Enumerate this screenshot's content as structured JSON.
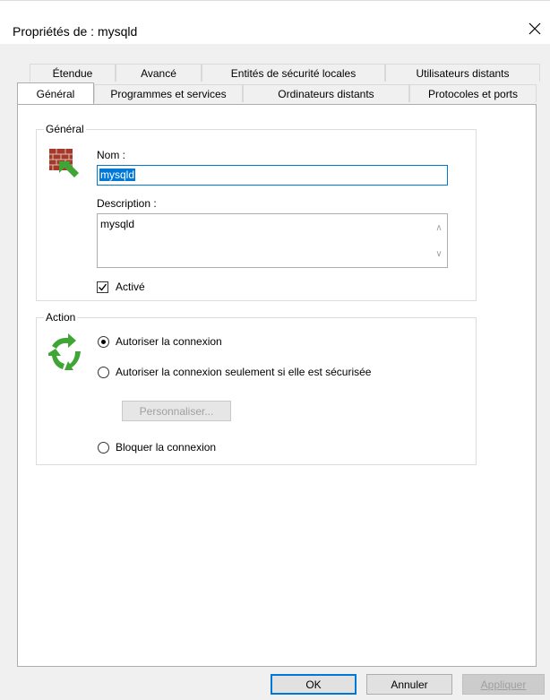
{
  "window": {
    "title": "Propriétés de : mysqld"
  },
  "tabs_top": [
    {
      "label": "Étendue"
    },
    {
      "label": "Avancé"
    },
    {
      "label": "Entités de sécurité locales"
    },
    {
      "label": "Utilisateurs distants"
    }
  ],
  "tabs_bottom": [
    {
      "label": "Général",
      "selected": true
    },
    {
      "label": "Programmes et services"
    },
    {
      "label": "Ordinateurs distants"
    },
    {
      "label": "Protocoles et ports"
    }
  ],
  "general": {
    "group_title": "Général",
    "icon": "firewall-brick-icon",
    "name_label": "Nom :",
    "name_value": "mysqld",
    "description_label": "Description :",
    "description_value": "mysqld",
    "enabled_label": "Activé",
    "enabled": true
  },
  "action": {
    "group_title": "Action",
    "icon": "refresh-arrows-icon",
    "options": [
      {
        "label": "Autoriser la connexion",
        "selected": true
      },
      {
        "label": "Autoriser la connexion seulement si elle est sécurisée",
        "selected": false
      },
      {
        "label": "Bloquer la connexion",
        "selected": false
      }
    ],
    "customize_label": "Personnaliser..."
  },
  "footer": {
    "ok_label": "OK",
    "cancel_label": "Annuler",
    "apply_label": "Appliquer"
  },
  "colors": {
    "accent": "#0078d7",
    "dialog_bg": "#f0f0f0",
    "icon_green": "#3fa535"
  }
}
